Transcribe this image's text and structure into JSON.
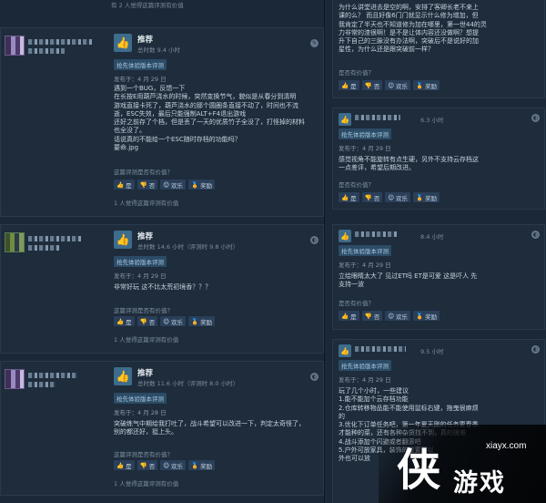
{
  "left": {
    "top_helpful": "有 2 人觉得这篇评测有价值",
    "reviews": [
      {
        "recommend": "推荐",
        "hours": "总时数 9.4 小时",
        "badge": "抢先体验版本评测",
        "posted": "发布于：4 月 29 日",
        "body": "遇到一个BUG，反馈一下\n在长按E用葫芦浇水的时候，突然变换节气，貌似是从春分到清明\n游戏直接卡死了，葫芦浇水的那个圆圈条直接不动了，时间也不流\n逝，ESC失效，最后只能强制ALT+F4退出游戏\n还好之前存了个档，但是丢了一天的优质竹子全没了，打怪掉的材料\n也全没了。\n话说真的不能给一个ESC随时存档的功能吗？\n要命.jpg",
        "helpful_q": "这篇评测是否有价值？",
        "yes": "是",
        "no": "否",
        "funny": "欢乐",
        "award": "奖励",
        "helpful_count": "1 人觉得这篇评测有价值"
      },
      {
        "recommend": "推荐",
        "hours": "总时数 14.6 小时（评测时 9.8 小时）",
        "badge": "抢先体验版本评测",
        "posted": "发布于：4 月 29 日",
        "body": "非常好玩 这不比太荒初境香？？？",
        "helpful_q": "这篇评测是否有价值？",
        "yes": "是",
        "no": "否",
        "funny": "欢乐",
        "award": "奖励",
        "helpful_count": "1 人觉得这篇评测有价值"
      },
      {
        "recommend": "推荐",
        "hours": "总时数 11.6 小时（评测时 8.0 小时）",
        "badge": "抢先体验版本评测",
        "posted": "发布于：4 月 28 日",
        "body": "突破练气中期给我打吐了，战斗希望可以改进一下，判定太奇怪了，\n别的都还好，挺上头。",
        "helpful_q": "这篇评测是否有价值？",
        "yes": "是",
        "no": "否",
        "funny": "欢乐",
        "award": "奖励",
        "helpful_count": "1 人觉得这篇评测有价值"
      }
    ]
  },
  "right": {
    "top_text": "为什么讲堂进去是空的啊，安排了客卿长老不来上\n课的么？ 而且好像6门门就显示什么修为增加，但\n我肯定了半天也不知道修为加在哪里，第一世44的灵\n力非常的渣很啊！是不是让体内容还没做啊？想提\n升下自己的三脉没有办法啊，突破后不是说好的加\n星性，为什么还是跟突破前一样？",
    "top_helpful_q": "是否有价值？",
    "reviews": [
      {
        "hours": "6.3 小时",
        "badge": "抢先体验版本评测",
        "posted": "发布于：4 月 29 日",
        "body": "感觉视角不能旋转有点生硬，另外不支持云存档这\n一点差评，希望后期改进。",
        "helpful_q": "是否有价值？"
      },
      {
        "hours": "8.4 小时",
        "badge": "抢先体验版本评测",
        "posted": "发布于：4 月 29 日",
        "body": "立绘眼睛太大了 见过ET吗 ET是可爱 这是吓人 先\n支持一波",
        "helpful_q": "是否有价值？"
      },
      {
        "hours": "9.5 小时",
        "badge": "抢先体验版本评测",
        "posted": "发布于：4 月 29 日",
        "body": "玩了几个小时，一些建议\n1.能不能加个云存档功能\n2.仓库转移物品能不能使用鼠标右键，拖曳很麻烦\n的\n3.优化下订单任务吧，第一年夏天刚的任务要春季\n才能种的菜，还有各种杂货找不到，真的很难\n4.战斗添加个闪避或者翻滚吧\n5.户外可放家具，装饰的位置可以\n外也可以放",
        "helpful_q": ""
      }
    ],
    "yes": "是",
    "no": "否",
    "funny": "欢乐",
    "award": "奖励"
  },
  "watermark": {
    "url": "xiayx.com",
    "char": "侠",
    "text": "游戏"
  }
}
